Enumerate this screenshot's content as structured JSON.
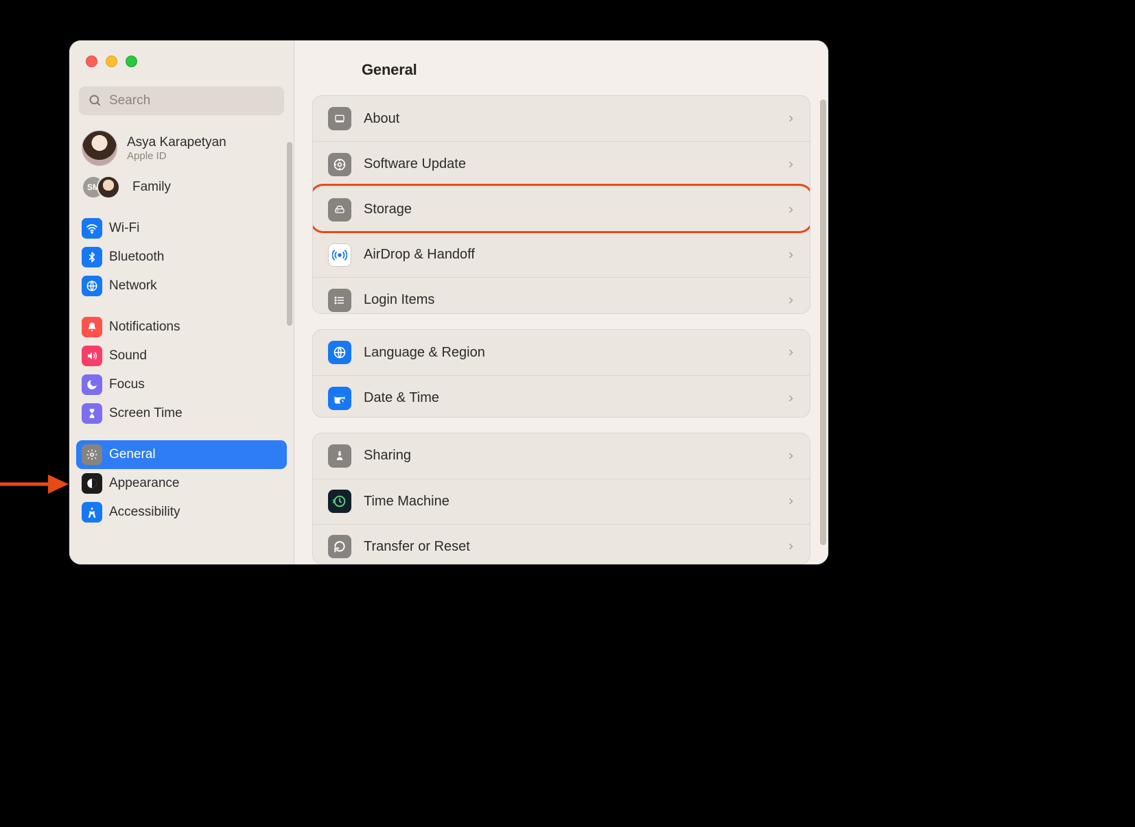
{
  "page_title": "General",
  "search": {
    "placeholder": "Search"
  },
  "account": {
    "name": "Asya Karapetyan",
    "subtitle": "Apple ID"
  },
  "family": {
    "label": "Family",
    "badge1": "SM"
  },
  "sidebar": {
    "items": [
      {
        "id": "wifi",
        "label": "Wi-Fi"
      },
      {
        "id": "bluetooth",
        "label": "Bluetooth"
      },
      {
        "id": "network",
        "label": "Network"
      },
      {
        "id": "notifications",
        "label": "Notifications"
      },
      {
        "id": "sound",
        "label": "Sound"
      },
      {
        "id": "focus",
        "label": "Focus"
      },
      {
        "id": "screentime",
        "label": "Screen Time"
      },
      {
        "id": "general",
        "label": "General"
      },
      {
        "id": "appearance",
        "label": "Appearance"
      },
      {
        "id": "accessibility",
        "label": "Accessibility"
      }
    ],
    "selected": "general"
  },
  "main": {
    "groups": [
      {
        "rows": [
          {
            "id": "about",
            "label": "About"
          },
          {
            "id": "software-update",
            "label": "Software Update"
          },
          {
            "id": "storage",
            "label": "Storage"
          },
          {
            "id": "airdrop-handoff",
            "label": "AirDrop & Handoff"
          },
          {
            "id": "login-items",
            "label": "Login Items"
          }
        ]
      },
      {
        "rows": [
          {
            "id": "language-region",
            "label": "Language & Region"
          },
          {
            "id": "date-time",
            "label": "Date & Time"
          }
        ]
      },
      {
        "rows": [
          {
            "id": "sharing",
            "label": "Sharing"
          },
          {
            "id": "time-machine",
            "label": "Time Machine"
          },
          {
            "id": "transfer-reset",
            "label": "Transfer or Reset"
          }
        ]
      }
    ]
  },
  "annotations": {
    "highlighted_row_id": "storage",
    "arrow_points_to_sidebar_id": "general"
  }
}
